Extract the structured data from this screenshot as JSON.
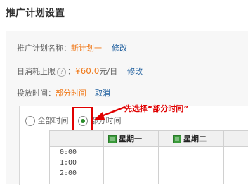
{
  "page": {
    "title": "推广计划设置"
  },
  "plan_name": {
    "label": "推广计划名称：",
    "value": "新计划一",
    "edit": "修改"
  },
  "daily_limit": {
    "label": "日消耗上限",
    "help": "?",
    "sep": "：",
    "value": "¥60.0",
    "unit": "元/日",
    "edit": "修改"
  },
  "schedule": {
    "label": "投放时间：",
    "value": "部分时间",
    "cancel": "取消",
    "option_all": "全部时间",
    "option_partial": "部分时间",
    "selected": "partial",
    "annotation": "先选择“部分时间”",
    "days": [
      "星期一",
      "星期二"
    ],
    "hours": [
      "0:00",
      "1:00",
      "2:00"
    ]
  },
  "colors": {
    "accent_orange": "#f07a1b",
    "link_blue": "#1f5f9e",
    "annotation_red": "#e00000",
    "radio_green": "#2a8d2a"
  }
}
